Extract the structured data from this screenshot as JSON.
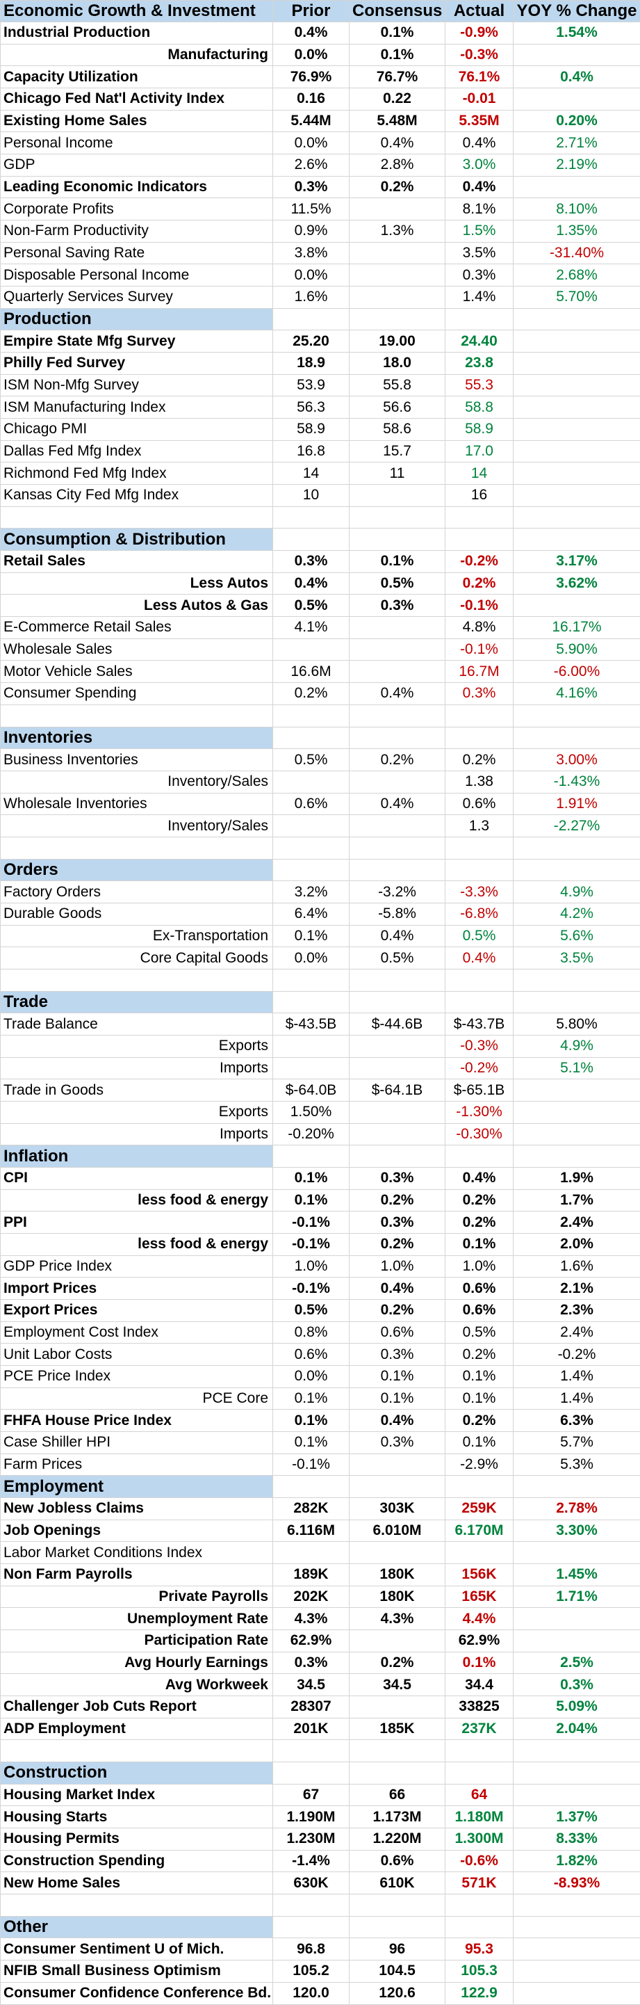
{
  "columns": [
    "Economic Growth & Investment",
    "Prior",
    "Consensus",
    "Actual",
    "YOY % Change"
  ],
  "colors": {
    "header_fill": "#bdd7ee",
    "negative": "#c00000",
    "positive": "#00833d"
  },
  "rows": [
    {
      "type": "row",
      "bold": true,
      "label": "Industrial Production",
      "prior": "0.4%",
      "consensus": "0.1%",
      "actual": "-0.9%",
      "actual_color": "red",
      "yoy": "1.54%",
      "yoy_color": "green"
    },
    {
      "type": "row",
      "bold": true,
      "sub": true,
      "label": "Manufacturing",
      "prior": "0.0%",
      "consensus": "0.1%",
      "actual": "-0.3%",
      "actual_color": "red",
      "yoy": ""
    },
    {
      "type": "row",
      "bold": true,
      "label": "Capacity Utilization",
      "prior": "76.9%",
      "consensus": "76.7%",
      "actual": "76.1%",
      "actual_color": "red",
      "yoy": "0.4%",
      "yoy_color": "green"
    },
    {
      "type": "row",
      "bold": true,
      "label": "Chicago Fed Nat'l Activity Index",
      "prior": "0.16",
      "consensus": "0.22",
      "actual": "-0.01",
      "actual_color": "red",
      "yoy": ""
    },
    {
      "type": "row",
      "bold": true,
      "label": "Existing Home Sales",
      "prior": "5.44M",
      "consensus": "5.48M",
      "actual": "5.35M",
      "actual_color": "red",
      "yoy": "0.20%",
      "yoy_color": "green"
    },
    {
      "type": "row",
      "label": "Personal Income",
      "prior": "0.0%",
      "consensus": "0.4%",
      "actual": "0.4%",
      "yoy": "2.71%",
      "yoy_color": "green"
    },
    {
      "type": "row",
      "label": "GDP",
      "prior": "2.6%",
      "consensus": "2.8%",
      "actual": "3.0%",
      "actual_color": "green",
      "yoy": "2.19%",
      "yoy_color": "green"
    },
    {
      "type": "row",
      "bold": true,
      "label": "Leading Economic Indicators",
      "prior": "0.3%",
      "consensus": "0.2%",
      "actual": "0.4%",
      "yoy": ""
    },
    {
      "type": "row",
      "label": "Corporate Profits",
      "prior": "11.5%",
      "consensus": "",
      "actual": "8.1%",
      "yoy": "8.10%",
      "yoy_color": "green"
    },
    {
      "type": "row",
      "label": "Non-Farm Productivity",
      "prior": "0.9%",
      "consensus": "1.3%",
      "actual": "1.5%",
      "actual_color": "green",
      "yoy": "1.35%",
      "yoy_color": "green"
    },
    {
      "type": "row",
      "label": "Personal Saving Rate",
      "prior": "3.8%",
      "consensus": "",
      "actual": "3.5%",
      "yoy": "-31.40%",
      "yoy_color": "red"
    },
    {
      "type": "row",
      "label": "Disposable Personal Income",
      "prior": "0.0%",
      "consensus": "",
      "actual": "0.3%",
      "yoy": "2.68%",
      "yoy_color": "green"
    },
    {
      "type": "row",
      "label": "Quarterly Services Survey",
      "prior": "1.6%",
      "consensus": "",
      "actual": "1.4%",
      "yoy": "5.70%",
      "yoy_color": "green"
    },
    {
      "type": "section",
      "label": "Production"
    },
    {
      "type": "row",
      "bold": true,
      "label": "Empire State Mfg Survey",
      "prior": "25.20",
      "consensus": "19.00",
      "actual": "24.40",
      "actual_color": "green",
      "yoy": ""
    },
    {
      "type": "row",
      "bold": true,
      "label": "Philly Fed Survey",
      "prior": "18.9",
      "consensus": "18.0",
      "actual": "23.8",
      "actual_color": "green",
      "yoy": ""
    },
    {
      "type": "row",
      "label": "ISM Non-Mfg Survey",
      "prior": "53.9",
      "consensus": "55.8",
      "actual": "55.3",
      "actual_color": "red",
      "yoy": ""
    },
    {
      "type": "row",
      "label": "ISM Manufacturing Index",
      "prior": "56.3",
      "consensus": "56.6",
      "actual": "58.8",
      "actual_color": "green",
      "yoy": ""
    },
    {
      "type": "row",
      "label": "Chicago PMI",
      "prior": "58.9",
      "consensus": "58.6",
      "actual": "58.9",
      "actual_color": "green",
      "yoy": ""
    },
    {
      "type": "row",
      "label": "Dallas Fed Mfg Index",
      "prior": "16.8",
      "consensus": "15.7",
      "actual": "17.0",
      "actual_color": "green",
      "yoy": ""
    },
    {
      "type": "row",
      "label": "Richmond Fed Mfg Index",
      "prior": "14",
      "consensus": "11",
      "actual": "14",
      "actual_color": "green",
      "yoy": ""
    },
    {
      "type": "row",
      "label": "Kansas City Fed Mfg Index",
      "prior": "10",
      "consensus": "",
      "actual": "16",
      "yoy": ""
    },
    {
      "type": "blank"
    },
    {
      "type": "section",
      "label": "Consumption & Distribution"
    },
    {
      "type": "row",
      "bold": true,
      "label": "Retail Sales",
      "prior": "0.3%",
      "consensus": "0.1%",
      "actual": "-0.2%",
      "actual_color": "red",
      "yoy": "3.17%",
      "yoy_color": "green"
    },
    {
      "type": "row",
      "bold": true,
      "sub": true,
      "label": "Less Autos",
      "prior": "0.4%",
      "consensus": "0.5%",
      "actual": "0.2%",
      "actual_color": "red",
      "yoy": "3.62%",
      "yoy_color": "green"
    },
    {
      "type": "row",
      "bold": true,
      "sub": true,
      "label": "Less Autos & Gas",
      "prior": "0.5%",
      "consensus": "0.3%",
      "actual": "-0.1%",
      "actual_color": "red",
      "yoy": ""
    },
    {
      "type": "row",
      "label": "E-Commerce Retail Sales",
      "prior": "4.1%",
      "consensus": "",
      "actual": "4.8%",
      "yoy": "16.17%",
      "yoy_color": "green"
    },
    {
      "type": "row",
      "label": "Wholesale Sales",
      "prior": "",
      "consensus": "",
      "actual": "-0.1%",
      "actual_color": "red",
      "yoy": "5.90%",
      "yoy_color": "green"
    },
    {
      "type": "row",
      "label": "Motor Vehicle Sales",
      "prior": "16.6M",
      "consensus": "",
      "actual": "16.7M",
      "actual_color": "red",
      "yoy": "-6.00%",
      "yoy_color": "red"
    },
    {
      "type": "row",
      "label": "Consumer Spending",
      "prior": "0.2%",
      "consensus": "0.4%",
      "actual": "0.3%",
      "actual_color": "red",
      "yoy": "4.16%",
      "yoy_color": "green"
    },
    {
      "type": "blank"
    },
    {
      "type": "section",
      "label": "Inventories"
    },
    {
      "type": "row",
      "label": "Business Inventories",
      "prior": "0.5%",
      "consensus": "0.2%",
      "actual": "0.2%",
      "yoy": "3.00%",
      "yoy_color": "red"
    },
    {
      "type": "row",
      "sub": true,
      "label": "Inventory/Sales",
      "prior": "",
      "consensus": "",
      "actual": "1.38",
      "yoy": "-1.43%",
      "yoy_color": "green"
    },
    {
      "type": "row",
      "label": "Wholesale Inventories",
      "prior": "0.6%",
      "consensus": "0.4%",
      "actual": "0.6%",
      "yoy": "1.91%",
      "yoy_color": "red"
    },
    {
      "type": "row",
      "sub": true,
      "label": "Inventory/Sales",
      "prior": "",
      "consensus": "",
      "actual": "1.3",
      "yoy": "-2.27%",
      "yoy_color": "green"
    },
    {
      "type": "blank"
    },
    {
      "type": "section",
      "label": "Orders"
    },
    {
      "type": "row",
      "label": "Factory Orders",
      "prior": "3.2%",
      "consensus": "-3.2%",
      "actual": "-3.3%",
      "actual_color": "red",
      "yoy": "4.9%",
      "yoy_color": "green"
    },
    {
      "type": "row",
      "label": "Durable Goods",
      "prior": "6.4%",
      "consensus": "-5.8%",
      "actual": "-6.8%",
      "actual_color": "red",
      "yoy": "4.2%",
      "yoy_color": "green"
    },
    {
      "type": "row",
      "sub": true,
      "label": "Ex-Transportation",
      "prior": "0.1%",
      "consensus": "0.4%",
      "actual": "0.5%",
      "actual_color": "green",
      "yoy": "5.6%",
      "yoy_color": "green"
    },
    {
      "type": "row",
      "sub": true,
      "label": "Core Capital Goods",
      "prior": "0.0%",
      "consensus": "0.5%",
      "actual": "0.4%",
      "actual_color": "red",
      "yoy": "3.5%",
      "yoy_color": "green"
    },
    {
      "type": "blank"
    },
    {
      "type": "section",
      "label": "Trade"
    },
    {
      "type": "row",
      "label": "Trade Balance",
      "prior": "$-43.5B",
      "consensus": "$-44.6B",
      "actual": "$-43.7B",
      "yoy": "5.80%"
    },
    {
      "type": "row",
      "sub": true,
      "label": "Exports",
      "prior": "",
      "consensus": "",
      "actual": "-0.3%",
      "actual_color": "red",
      "yoy": "4.9%",
      "yoy_color": "green"
    },
    {
      "type": "row",
      "sub": true,
      "label": "Imports",
      "prior": "",
      "consensus": "",
      "actual": "-0.2%",
      "actual_color": "red",
      "yoy": "5.1%",
      "yoy_color": "green"
    },
    {
      "type": "row",
      "label": "Trade in Goods",
      "prior": "$-64.0B",
      "consensus": "$-64.1B",
      "actual": "$-65.1B",
      "yoy": ""
    },
    {
      "type": "row",
      "sub": true,
      "label": "Exports",
      "prior": "1.50%",
      "consensus": "",
      "actual": "-1.30%",
      "actual_color": "red",
      "yoy": ""
    },
    {
      "type": "row",
      "sub": true,
      "label": "Imports",
      "prior": "-0.20%",
      "consensus": "",
      "actual": "-0.30%",
      "actual_color": "red",
      "yoy": ""
    },
    {
      "type": "section",
      "label": "Inflation"
    },
    {
      "type": "row",
      "bold": true,
      "label": "CPI",
      "prior": "0.1%",
      "consensus": "0.3%",
      "actual": "0.4%",
      "yoy": "1.9%"
    },
    {
      "type": "row",
      "bold": true,
      "sub": true,
      "label": "less food & energy",
      "prior": "0.1%",
      "consensus": "0.2%",
      "actual": "0.2%",
      "yoy": "1.7%"
    },
    {
      "type": "row",
      "bold": true,
      "label": "PPI",
      "prior": "-0.1%",
      "consensus": "0.3%",
      "actual": "0.2%",
      "yoy": "2.4%"
    },
    {
      "type": "row",
      "bold": true,
      "sub": true,
      "label": "less food & energy",
      "prior": "-0.1%",
      "consensus": "0.2%",
      "actual": "0.1%",
      "yoy": "2.0%"
    },
    {
      "type": "row",
      "label": "GDP Price Index",
      "prior": "1.0%",
      "consensus": "1.0%",
      "actual": "1.0%",
      "yoy": "1.6%"
    },
    {
      "type": "row",
      "bold": true,
      "label": "Import Prices",
      "prior": "-0.1%",
      "consensus": "0.4%",
      "actual": "0.6%",
      "yoy": "2.1%"
    },
    {
      "type": "row",
      "bold": true,
      "label": "Export Prices",
      "prior": "0.5%",
      "consensus": "0.2%",
      "actual": "0.6%",
      "yoy": "2.3%"
    },
    {
      "type": "row",
      "label": "Employment Cost Index",
      "prior": "0.8%",
      "consensus": "0.6%",
      "actual": "0.5%",
      "yoy": "2.4%"
    },
    {
      "type": "row",
      "label": "Unit Labor Costs",
      "prior": "0.6%",
      "consensus": "0.3%",
      "actual": "0.2%",
      "yoy": "-0.2%"
    },
    {
      "type": "row",
      "label": "PCE Price Index",
      "prior": "0.0%",
      "consensus": "0.1%",
      "actual": "0.1%",
      "yoy": "1.4%"
    },
    {
      "type": "row",
      "sub": true,
      "label": "PCE Core",
      "prior": "0.1%",
      "consensus": "0.1%",
      "actual": "0.1%",
      "yoy": "1.4%"
    },
    {
      "type": "row",
      "bold": true,
      "label": "FHFA House Price Index",
      "prior": "0.1%",
      "consensus": "0.4%",
      "actual": "0.2%",
      "yoy": "6.3%"
    },
    {
      "type": "row",
      "label": "Case Shiller HPI",
      "prior": "0.1%",
      "consensus": "0.3%",
      "actual": "0.1%",
      "yoy": "5.7%"
    },
    {
      "type": "row",
      "label": "Farm Prices",
      "prior": "-0.1%",
      "consensus": "",
      "actual": "-2.9%",
      "yoy": "5.3%"
    },
    {
      "type": "section",
      "label": "Employment"
    },
    {
      "type": "row",
      "bold": true,
      "label": "New Jobless Claims",
      "prior": "282K",
      "consensus": "303K",
      "actual": "259K",
      "actual_color": "red",
      "yoy": "2.78%",
      "yoy_color": "red"
    },
    {
      "type": "row",
      "bold": true,
      "label": "Job Openings",
      "prior": "6.116M",
      "consensus": "6.010M",
      "actual": "6.170M",
      "actual_color": "green",
      "yoy": "3.30%",
      "yoy_color": "green"
    },
    {
      "type": "row",
      "label": "Labor Market Conditions Index",
      "prior": "",
      "consensus": "",
      "actual": "",
      "yoy": ""
    },
    {
      "type": "row",
      "bold": true,
      "label": "Non Farm Payrolls",
      "prior": "189K",
      "consensus": "180K",
      "actual": "156K",
      "actual_color": "red",
      "yoy": "1.45%",
      "yoy_color": "green"
    },
    {
      "type": "row",
      "bold": true,
      "sub": true,
      "label": "Private Payrolls",
      "prior": "202K",
      "consensus": "180K",
      "actual": "165K",
      "actual_color": "red",
      "yoy": "1.71%",
      "yoy_color": "green"
    },
    {
      "type": "row",
      "bold": true,
      "sub": true,
      "label": "Unemployment Rate",
      "prior": "4.3%",
      "consensus": "4.3%",
      "actual": "4.4%",
      "actual_color": "red",
      "yoy": ""
    },
    {
      "type": "row",
      "bold": true,
      "sub": true,
      "label": "Participation Rate",
      "prior": "62.9%",
      "consensus": "",
      "actual": "62.9%",
      "yoy": ""
    },
    {
      "type": "row",
      "bold": true,
      "sub": true,
      "label": "Avg Hourly Earnings",
      "prior": "0.3%",
      "consensus": "0.2%",
      "actual": "0.1%",
      "actual_color": "red",
      "yoy": "2.5%",
      "yoy_color": "green"
    },
    {
      "type": "row",
      "bold": true,
      "sub": true,
      "label": "Avg Workweek",
      "prior": "34.5",
      "consensus": "34.5",
      "actual": "34.4",
      "yoy": "0.3%",
      "yoy_color": "green"
    },
    {
      "type": "row",
      "bold": true,
      "label": "Challenger Job Cuts Report",
      "prior": "28307",
      "consensus": "",
      "actual": "33825",
      "yoy": "5.09%",
      "yoy_color": "green"
    },
    {
      "type": "row",
      "bold": true,
      "label": "ADP Employment",
      "prior": "201K",
      "consensus": "185K",
      "actual": "237K",
      "actual_color": "green",
      "yoy": "2.04%",
      "yoy_color": "green"
    },
    {
      "type": "blank"
    },
    {
      "type": "section",
      "label": "Construction"
    },
    {
      "type": "row",
      "bold": true,
      "label": "Housing Market Index",
      "prior": "67",
      "consensus": "66",
      "actual": "64",
      "actual_color": "red",
      "yoy": ""
    },
    {
      "type": "row",
      "bold": true,
      "label": "Housing Starts",
      "prior": "1.190M",
      "consensus": "1.173M",
      "actual": "1.180M",
      "actual_color": "green",
      "yoy": "1.37%",
      "yoy_color": "green"
    },
    {
      "type": "row",
      "bold": true,
      "label": "Housing Permits",
      "prior": "1.230M",
      "consensus": "1.220M",
      "actual": "1.300M",
      "actual_color": "green",
      "yoy": "8.33%",
      "yoy_color": "green"
    },
    {
      "type": "row",
      "bold": true,
      "label": "Construction Spending",
      "prior": "-1.4%",
      "consensus": "0.6%",
      "actual": "-0.6%",
      "actual_color": "red",
      "yoy": "1.82%",
      "yoy_color": "green"
    },
    {
      "type": "row",
      "bold": true,
      "label": "New Home Sales",
      "prior": "630K",
      "consensus": "610K",
      "actual": "571K",
      "actual_color": "red",
      "yoy": "-8.93%",
      "yoy_color": "red"
    },
    {
      "type": "blank"
    },
    {
      "type": "section",
      "label": "Other"
    },
    {
      "type": "row",
      "bold": true,
      "label": "Consumer Sentiment U of Mich.",
      "prior": "96.8",
      "consensus": "96",
      "actual": "95.3",
      "actual_color": "red",
      "yoy": ""
    },
    {
      "type": "row",
      "bold": true,
      "label": "NFIB Small Business Optimism",
      "prior": "105.2",
      "consensus": "104.5",
      "actual": "105.3",
      "actual_color": "green",
      "yoy": ""
    },
    {
      "type": "row",
      "bold": true,
      "label": "Consumer Confidence Conference Bd.",
      "prior": "120.0",
      "consensus": "120.6",
      "actual": "122.9",
      "actual_color": "green",
      "yoy": ""
    }
  ]
}
